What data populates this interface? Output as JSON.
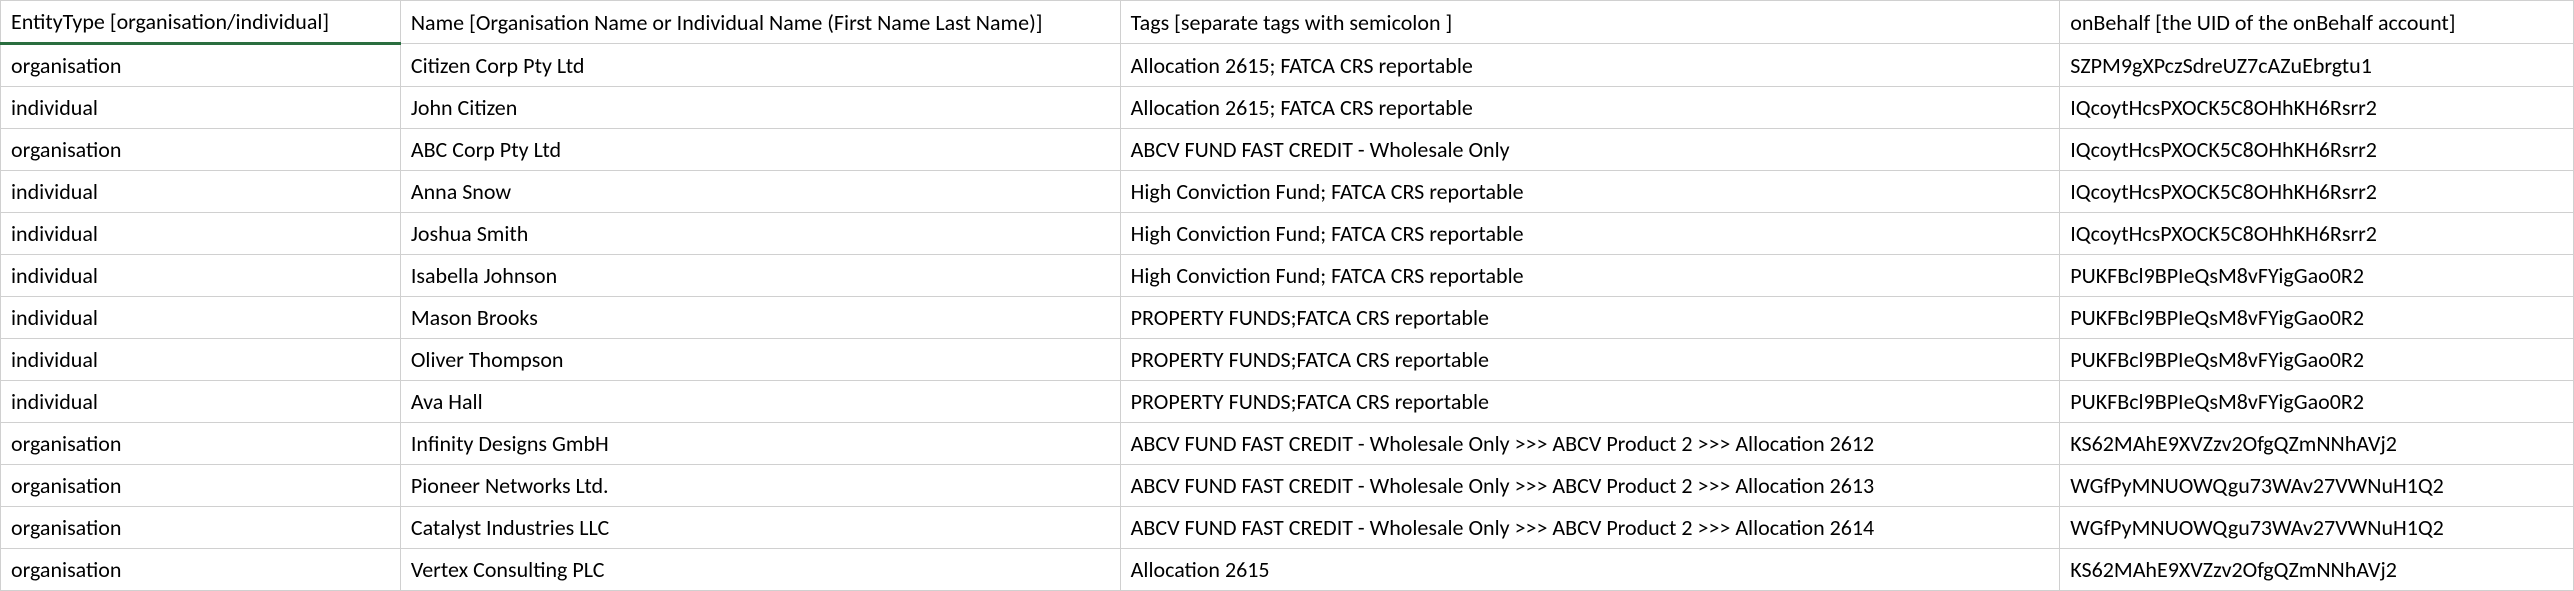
{
  "headers": {
    "entityType": "EntityType [organisation/individual]",
    "name": "Name [Organisation Name or Individual Name (First Name Last Name)]",
    "tags": "Tags [separate tags with semicolon ]",
    "onBehalf": "onBehalf [the UID of the onBehalf account]"
  },
  "rows": [
    {
      "entityType": "organisation",
      "name": "Citizen Corp Pty Ltd",
      "tags": "Allocation 2615; FATCA CRS reportable",
      "onBehalf": "SZPM9gXPczSdreUZ7cAZuEbrgtu1"
    },
    {
      "entityType": "individual",
      "name": "John Citizen",
      "tags": "Allocation 2615; FATCA CRS reportable",
      "onBehalf": "IQcoytHcsPXOCK5C8OHhKH6Rsrr2"
    },
    {
      "entityType": "organisation",
      "name": "ABC Corp Pty Ltd",
      "tags": "ABCV FUND FAST CREDIT - Wholesale Only",
      "onBehalf": "IQcoytHcsPXOCK5C8OHhKH6Rsrr2"
    },
    {
      "entityType": "individual",
      "name": "Anna Snow",
      "tags": "High Conviction Fund; FATCA CRS reportable",
      "onBehalf": "IQcoytHcsPXOCK5C8OHhKH6Rsrr2"
    },
    {
      "entityType": "individual",
      "name": "Joshua Smith",
      "tags": "High Conviction Fund; FATCA CRS reportable",
      "onBehalf": "IQcoytHcsPXOCK5C8OHhKH6Rsrr2"
    },
    {
      "entityType": "individual",
      "name": "Isabella Johnson",
      "tags": "High Conviction Fund; FATCA CRS reportable",
      "onBehalf": "PUKFBcl9BPIeQsM8vFYigGao0R2"
    },
    {
      "entityType": "individual",
      "name": "Mason Brooks",
      "tags": "PROPERTY FUNDS;FATCA CRS reportable",
      "onBehalf": "PUKFBcl9BPIeQsM8vFYigGao0R2"
    },
    {
      "entityType": "individual",
      "name": "Oliver Thompson",
      "tags": "PROPERTY FUNDS;FATCA CRS reportable",
      "onBehalf": "PUKFBcl9BPIeQsM8vFYigGao0R2"
    },
    {
      "entityType": "individual",
      "name": "Ava Hall",
      "tags": "PROPERTY FUNDS;FATCA CRS reportable",
      "onBehalf": "PUKFBcl9BPIeQsM8vFYigGao0R2"
    },
    {
      "entityType": "organisation",
      "name": "Infinity Designs GmbH",
      "tags": "ABCV FUND FAST CREDIT - Wholesale Only >>> ABCV Product 2 >>> Allocation 2612",
      "onBehalf": "KS62MAhE9XVZzv2OfgQZmNNhAVj2"
    },
    {
      "entityType": "organisation",
      "name": "Pioneer Networks Ltd.",
      "tags": "ABCV FUND FAST CREDIT - Wholesale Only >>> ABCV Product 2 >>> Allocation 2613",
      "onBehalf": "WGfPyMNUOWQgu73WAv27VWNuH1Q2"
    },
    {
      "entityType": "organisation",
      "name": "Catalyst Industries LLC",
      "tags": "ABCV FUND FAST CREDIT - Wholesale Only >>> ABCV Product 2 >>> Allocation 2614",
      "onBehalf": "WGfPyMNUOWQgu73WAv27VWNuH1Q2"
    },
    {
      "entityType": "organisation",
      "name": "Vertex Consulting PLC",
      "tags": "Allocation 2615",
      "onBehalf": "KS62MAhE9XVZzv2OfgQZmNNhAVj2"
    }
  ]
}
